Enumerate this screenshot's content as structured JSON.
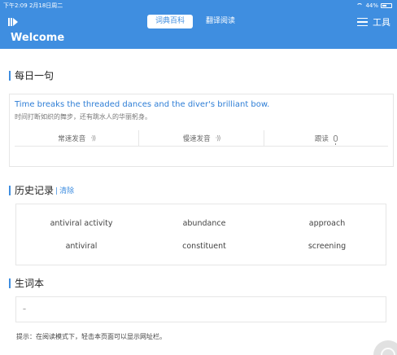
{
  "status_bar": {
    "time_date": "下午2:09  2月18日周二",
    "battery": "44%"
  },
  "header": {
    "tabs": [
      {
        "label": "词典百科",
        "active": true
      },
      {
        "label": "翻译阅读",
        "active": false
      }
    ],
    "tools_label": "工具",
    "welcome": "Welcome"
  },
  "daily_sentence": {
    "title": "每日一句",
    "english": "Time breaks the threaded dances and the diver's brilliant bow.",
    "chinese": "时间打断如织的舞步，还有跳水人的华丽躬身。",
    "actions": [
      {
        "label": "常速发音",
        "icon": "sound-icon"
      },
      {
        "label": "慢速发音",
        "icon": "sound-icon"
      },
      {
        "label": "跟读",
        "icon": "mic-icon"
      }
    ]
  },
  "history": {
    "title": "历史记录",
    "clear_label": "清除",
    "items": [
      "antiviral activity",
      "abundance",
      "approach",
      "antiviral",
      "constituent",
      "screening"
    ]
  },
  "vocabulary": {
    "title": "生词本",
    "content": "–"
  },
  "tip": "提示：在阅读模式下，轻击本页面可以显示网址栏。",
  "colors": {
    "accent": "#3f8ee0",
    "sentence_text": "#2e7ed6"
  }
}
